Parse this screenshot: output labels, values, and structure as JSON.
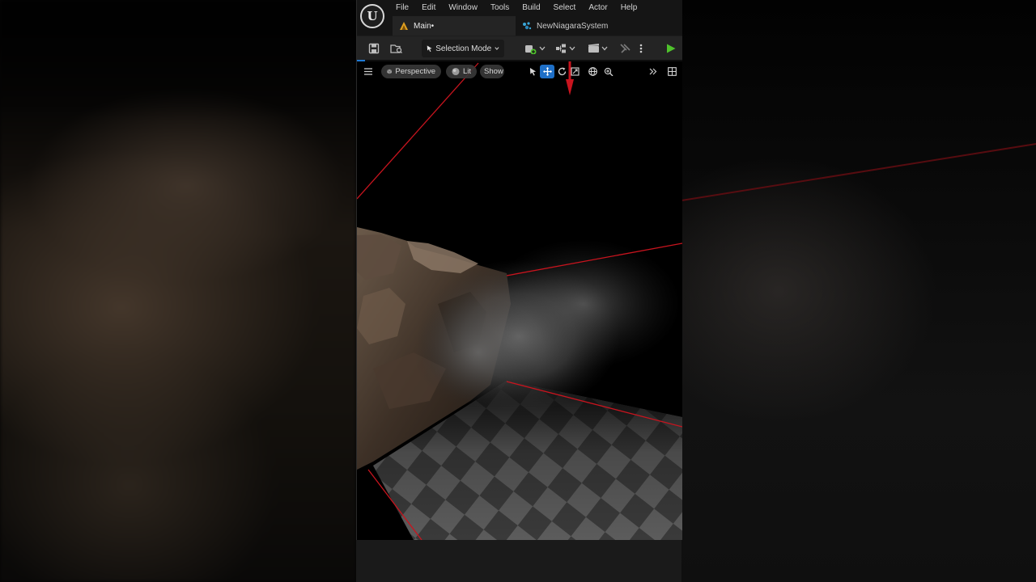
{
  "app": {
    "logo_letter": "U"
  },
  "menu": {
    "items": [
      "File",
      "Edit",
      "Window",
      "Tools",
      "Build",
      "Select",
      "Actor",
      "Help"
    ]
  },
  "tabs": [
    {
      "label": "Main•",
      "icon": "level-icon",
      "active": true
    },
    {
      "label": "NewNiagaraSystem",
      "icon": "niagara-icon",
      "active": false
    }
  ],
  "toolbar": {
    "mode_label": "Selection Mode",
    "icons": [
      "save-icon",
      "browse-icon",
      "add-actor-icon",
      "blueprint-icon",
      "cinematics-icon",
      "platform-icon",
      "more-icon",
      "play-icon"
    ]
  },
  "viewport": {
    "perspective_label": "Perspective",
    "lit_label": "Lit",
    "show_label": "Show"
  },
  "colors": {
    "accent_blue": "#1e7bd6",
    "play_green": "#4fc22c",
    "bounds_red": "#c8141e",
    "panel_bg": "#242424"
  }
}
